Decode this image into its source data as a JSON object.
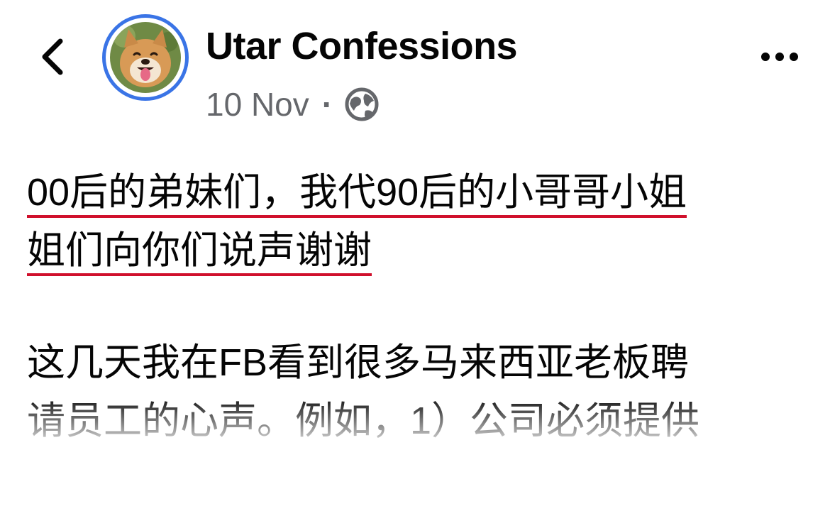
{
  "header": {
    "page_name": "Utar Confessions",
    "date": "10 Nov",
    "separator": "·",
    "privacy_icon": "globe-icon",
    "back_icon": "chevron-left-icon",
    "more_icon": "more-horizontal-icon",
    "avatar_ring_color": "#3a74e6"
  },
  "post": {
    "title_line1": "00后的弟妹们，我代90后的小哥哥小姐",
    "title_line2": "姐们向你们说声谢谢",
    "body_line1": "这几天我在FB看到很多马来西亚老板聘",
    "body_line2": "请员工的心声。例如，1）公司必须提供"
  },
  "colors": {
    "underline": "#d0102c",
    "meta_text": "#65676b",
    "text": "#050505"
  }
}
